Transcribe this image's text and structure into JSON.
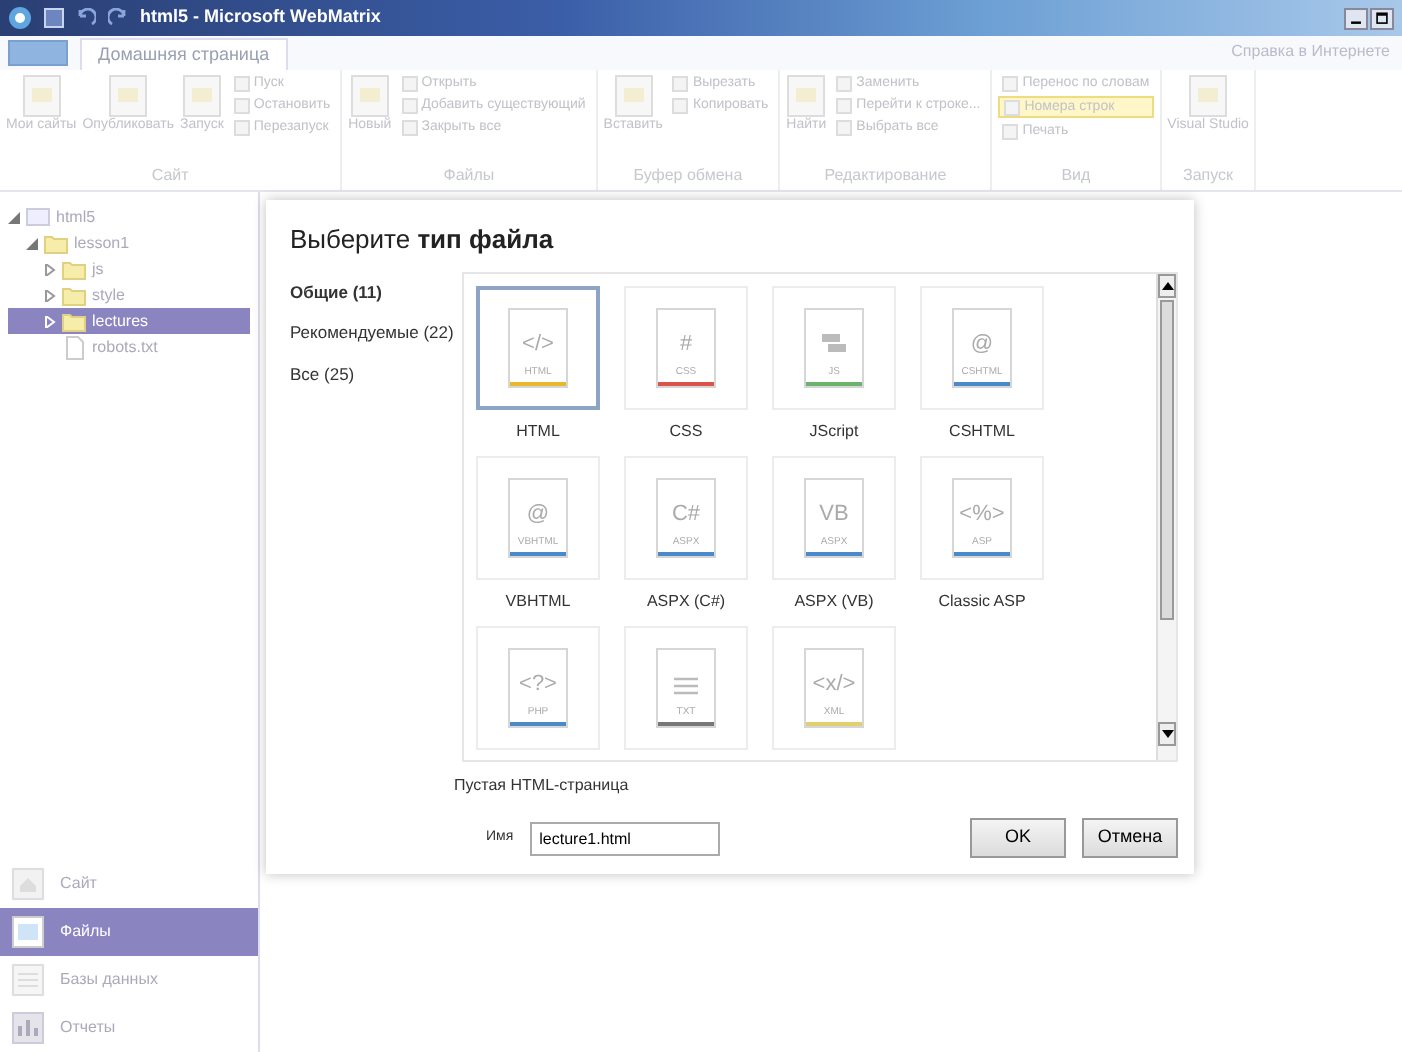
{
  "window": {
    "title": "html5 - Microsoft WebMatrix"
  },
  "ribbon": {
    "tabs": [
      {
        "label": "Домашняя страница",
        "selected": true
      }
    ],
    "help_link": "Справка в Интернете",
    "groups": [
      {
        "label": "Сайт",
        "items": [
          {
            "label": "Мои сайты",
            "kind": "large"
          },
          {
            "label": "Опубликовать",
            "kind": "large"
          },
          {
            "label": "Запуск",
            "kind": "large"
          },
          {
            "label": "Пуск",
            "kind": "small"
          },
          {
            "label": "Остановить",
            "kind": "small"
          },
          {
            "label": "Перезапуск",
            "kind": "small"
          }
        ]
      },
      {
        "label": "Файлы",
        "items": [
          {
            "label": "Новый",
            "kind": "large"
          },
          {
            "label": "Открыть",
            "kind": "small"
          },
          {
            "label": "Добавить существующий",
            "kind": "small"
          },
          {
            "label": "Закрыть все",
            "kind": "small"
          }
        ]
      },
      {
        "label": "Буфер обмена",
        "items": [
          {
            "label": "Вставить",
            "kind": "large"
          },
          {
            "label": "Вырезать",
            "kind": "small"
          },
          {
            "label": "Копировать",
            "kind": "small"
          }
        ]
      },
      {
        "label": "Редактирование",
        "items": [
          {
            "label": "Найти",
            "kind": "large"
          },
          {
            "label": "Заменить",
            "kind": "small"
          },
          {
            "label": "Перейти к строке...",
            "kind": "small"
          },
          {
            "label": "Выбрать все",
            "kind": "small"
          }
        ]
      },
      {
        "label": "Вид",
        "items": [
          {
            "label": "Перенос по словам",
            "kind": "small",
            "on": false
          },
          {
            "label": "Номера строк",
            "kind": "small",
            "on": true
          },
          {
            "label": "Печать",
            "kind": "small",
            "on": false
          }
        ]
      },
      {
        "label": "Запуск",
        "items": [
          {
            "label": "Visual Studio",
            "kind": "large"
          }
        ]
      }
    ]
  },
  "tree": [
    {
      "label": "html5",
      "expanded": true,
      "selected": false,
      "kind": "site",
      "children": [
        {
          "label": "lesson1",
          "expanded": true,
          "selected": false,
          "kind": "folder",
          "children": [
            {
              "label": "js",
              "expanded": false,
              "selected": false,
              "kind": "folder"
            },
            {
              "label": "style",
              "expanded": false,
              "selected": false,
              "kind": "folder"
            },
            {
              "label": "lectures",
              "expanded": false,
              "selected": true,
              "kind": "folder"
            },
            {
              "label": "robots.txt",
              "selected": false,
              "kind": "file"
            }
          ]
        }
      ]
    }
  ],
  "workspaces": [
    {
      "label": "Сайт",
      "selected": false,
      "kind": "site"
    },
    {
      "label": "Файлы",
      "selected": true,
      "kind": "files"
    },
    {
      "label": "Базы данных",
      "selected": false,
      "kind": "database"
    },
    {
      "label": "Отчеты",
      "selected": false,
      "kind": "reports"
    }
  ],
  "dialog": {
    "title": "Выберите **тип файла**",
    "categories": [
      {
        "label": "Общие (11)",
        "selected": true
      },
      {
        "label": "Рекомендуемые (22)",
        "selected": false
      },
      {
        "label": "Все (25)",
        "selected": false
      }
    ],
    "file_types": [
      {
        "label": "HTML",
        "symbol": "</>",
        "tag": "HTML",
        "color": "#e8b830",
        "kind": "symbol",
        "selected": true
      },
      {
        "label": "CSS",
        "symbol": "#",
        "tag": "CSS",
        "color": "#d9534f",
        "kind": "symbol",
        "selected": false
      },
      {
        "label": "JScript",
        "tag": "JS",
        "color": "#6db36d",
        "kind": "script",
        "selected": false
      },
      {
        "label": "CSHTML",
        "symbol": "@",
        "tag": "CSHTML",
        "color": "#4a8ac8",
        "kind": "symbol",
        "selected": false
      },
      {
        "label": "VBHTML",
        "symbol": "@",
        "tag": "VBHTML",
        "color": "#4a8ac8",
        "kind": "symbol",
        "selected": false
      },
      {
        "label": "ASPX (C#)",
        "symbol": "C#",
        "tag": "ASPX",
        "color": "#4a8ac8",
        "kind": "symbol",
        "selected": false
      },
      {
        "label": "ASPX (VB)",
        "symbol": "VB",
        "tag": "ASPX",
        "color": "#4a8ac8",
        "kind": "symbol",
        "selected": false
      },
      {
        "label": "Classic ASP",
        "symbol": "<%>",
        "tag": "ASP",
        "color": "#4a8ac8",
        "kind": "symbol",
        "selected": false
      },
      {
        "symbol": "<?>",
        "tag": "PHP",
        "color": "#4a8ac8",
        "kind": "symbol",
        "selected": false
      },
      {
        "tag": "TXT",
        "color": "#777777",
        "kind": "lines",
        "selected": false
      },
      {
        "symbol": "<x/>",
        "tag": "XML",
        "color": "#e0d070",
        "kind": "symbol",
        "selected": false
      }
    ],
    "description": "Пустая HTML-страница",
    "name_label": "Имя",
    "name_value": "lecture1.html",
    "buttons": [
      "OK",
      "Отмена"
    ]
  }
}
